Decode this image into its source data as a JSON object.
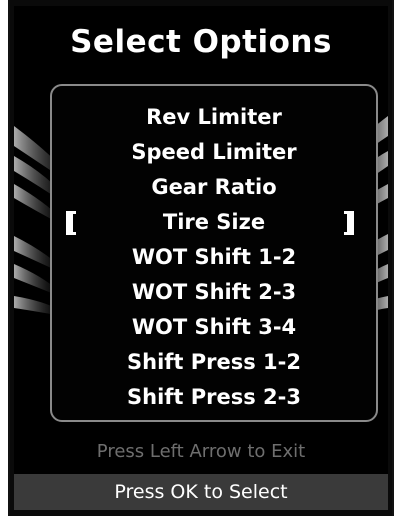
{
  "screen": {
    "title": "Select Options",
    "menu_items": [
      {
        "label": "Rev Limiter"
      },
      {
        "label": "Speed Limiter"
      },
      {
        "label": "Gear Ratio"
      },
      {
        "label": "Tire Size"
      },
      {
        "label": "WOT Shift 1-2"
      },
      {
        "label": "WOT Shift 2-3"
      },
      {
        "label": "WOT Shift 3-4"
      },
      {
        "label": "Shift Press 1-2"
      },
      {
        "label": "Shift Press 2-3"
      }
    ],
    "selected_index": 3,
    "exit_hint": "Press Left Arrow to Exit",
    "select_hint": "Press OK to Select"
  },
  "colors": {
    "background": "#000000",
    "text": "#ffffff",
    "hint_text": "#6e6e6e",
    "footer_bar": "#3a3a3a",
    "panel_border": "#8a8a8a"
  }
}
